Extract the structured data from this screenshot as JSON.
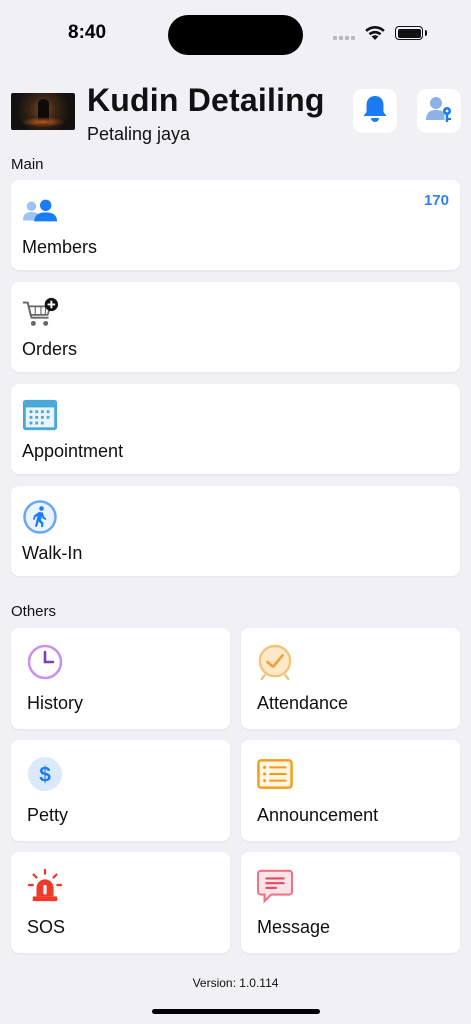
{
  "status_bar": {
    "time": "8:40"
  },
  "header": {
    "title": "Kudin Detailing",
    "subtitle": "Petaling jaya",
    "bell_icon": "bell-icon",
    "user_icon": "user-key-icon"
  },
  "sections": {
    "main": "Main",
    "others": "Others"
  },
  "main_items": [
    {
      "label": "Members",
      "icon": "members-icon",
      "badge": "170"
    },
    {
      "label": "Orders",
      "icon": "cart-add-icon"
    },
    {
      "label": "Appointment",
      "icon": "calendar-icon"
    },
    {
      "label": "Walk-In",
      "icon": "walk-icon"
    }
  ],
  "other_items": [
    {
      "label": "History",
      "icon": "clock-icon"
    },
    {
      "label": "Attendance",
      "icon": "alarm-icon"
    },
    {
      "label": "Petty",
      "icon": "dollar-icon"
    },
    {
      "label": "Announcement",
      "icon": "list-icon"
    },
    {
      "label": "SOS",
      "icon": "siren-icon"
    },
    {
      "label": "Message",
      "icon": "message-icon"
    }
  ],
  "footer": {
    "version": "Version: 1.0.114"
  },
  "colors": {
    "background": "#f1f1f5",
    "accent_blue": "#1a7cf5",
    "badge_blue": "#2f80ed",
    "history_purple": "#c891ee",
    "attendance_orange": "#f0a23a",
    "announcement_orange": "#f39c12",
    "sos_red": "#f0392a",
    "message_pink": "#f07386"
  }
}
